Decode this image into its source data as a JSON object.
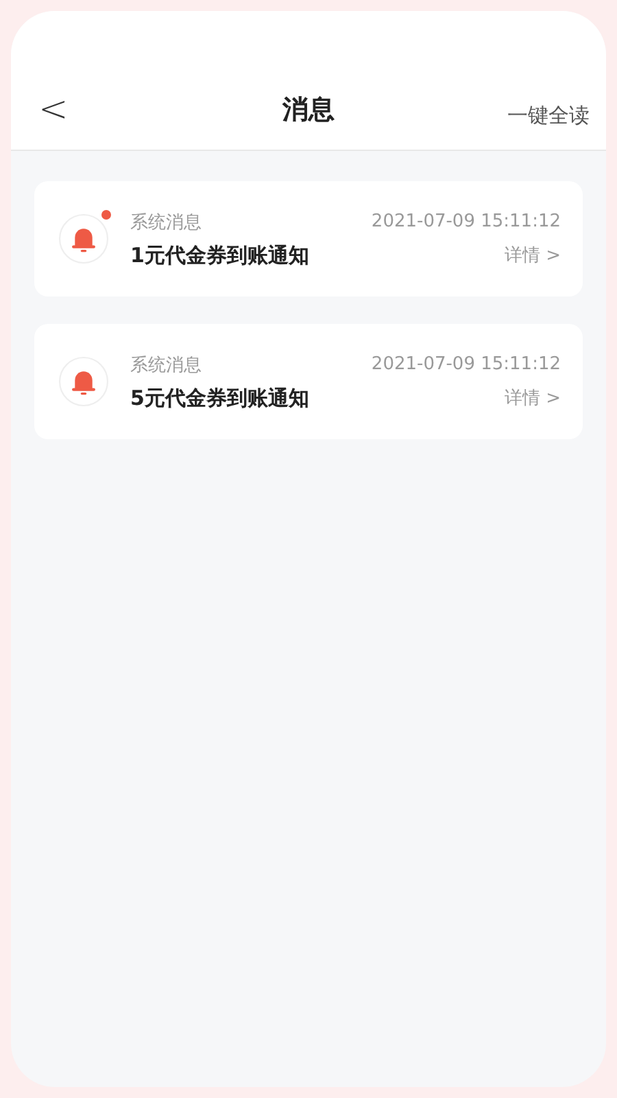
{
  "header": {
    "back_icon": "<",
    "title": "消息",
    "action": "一键全读"
  },
  "messages": [
    {
      "category": "系统消息",
      "time": "2021-07-09 15:11:12",
      "title": "1元代金券到账通知",
      "link": "详情 >",
      "unread": true
    },
    {
      "category": "系统消息",
      "time": "2021-07-09 15:11:12",
      "title": "5元代金券到账通知",
      "link": "详情 >",
      "unread": false
    }
  ]
}
